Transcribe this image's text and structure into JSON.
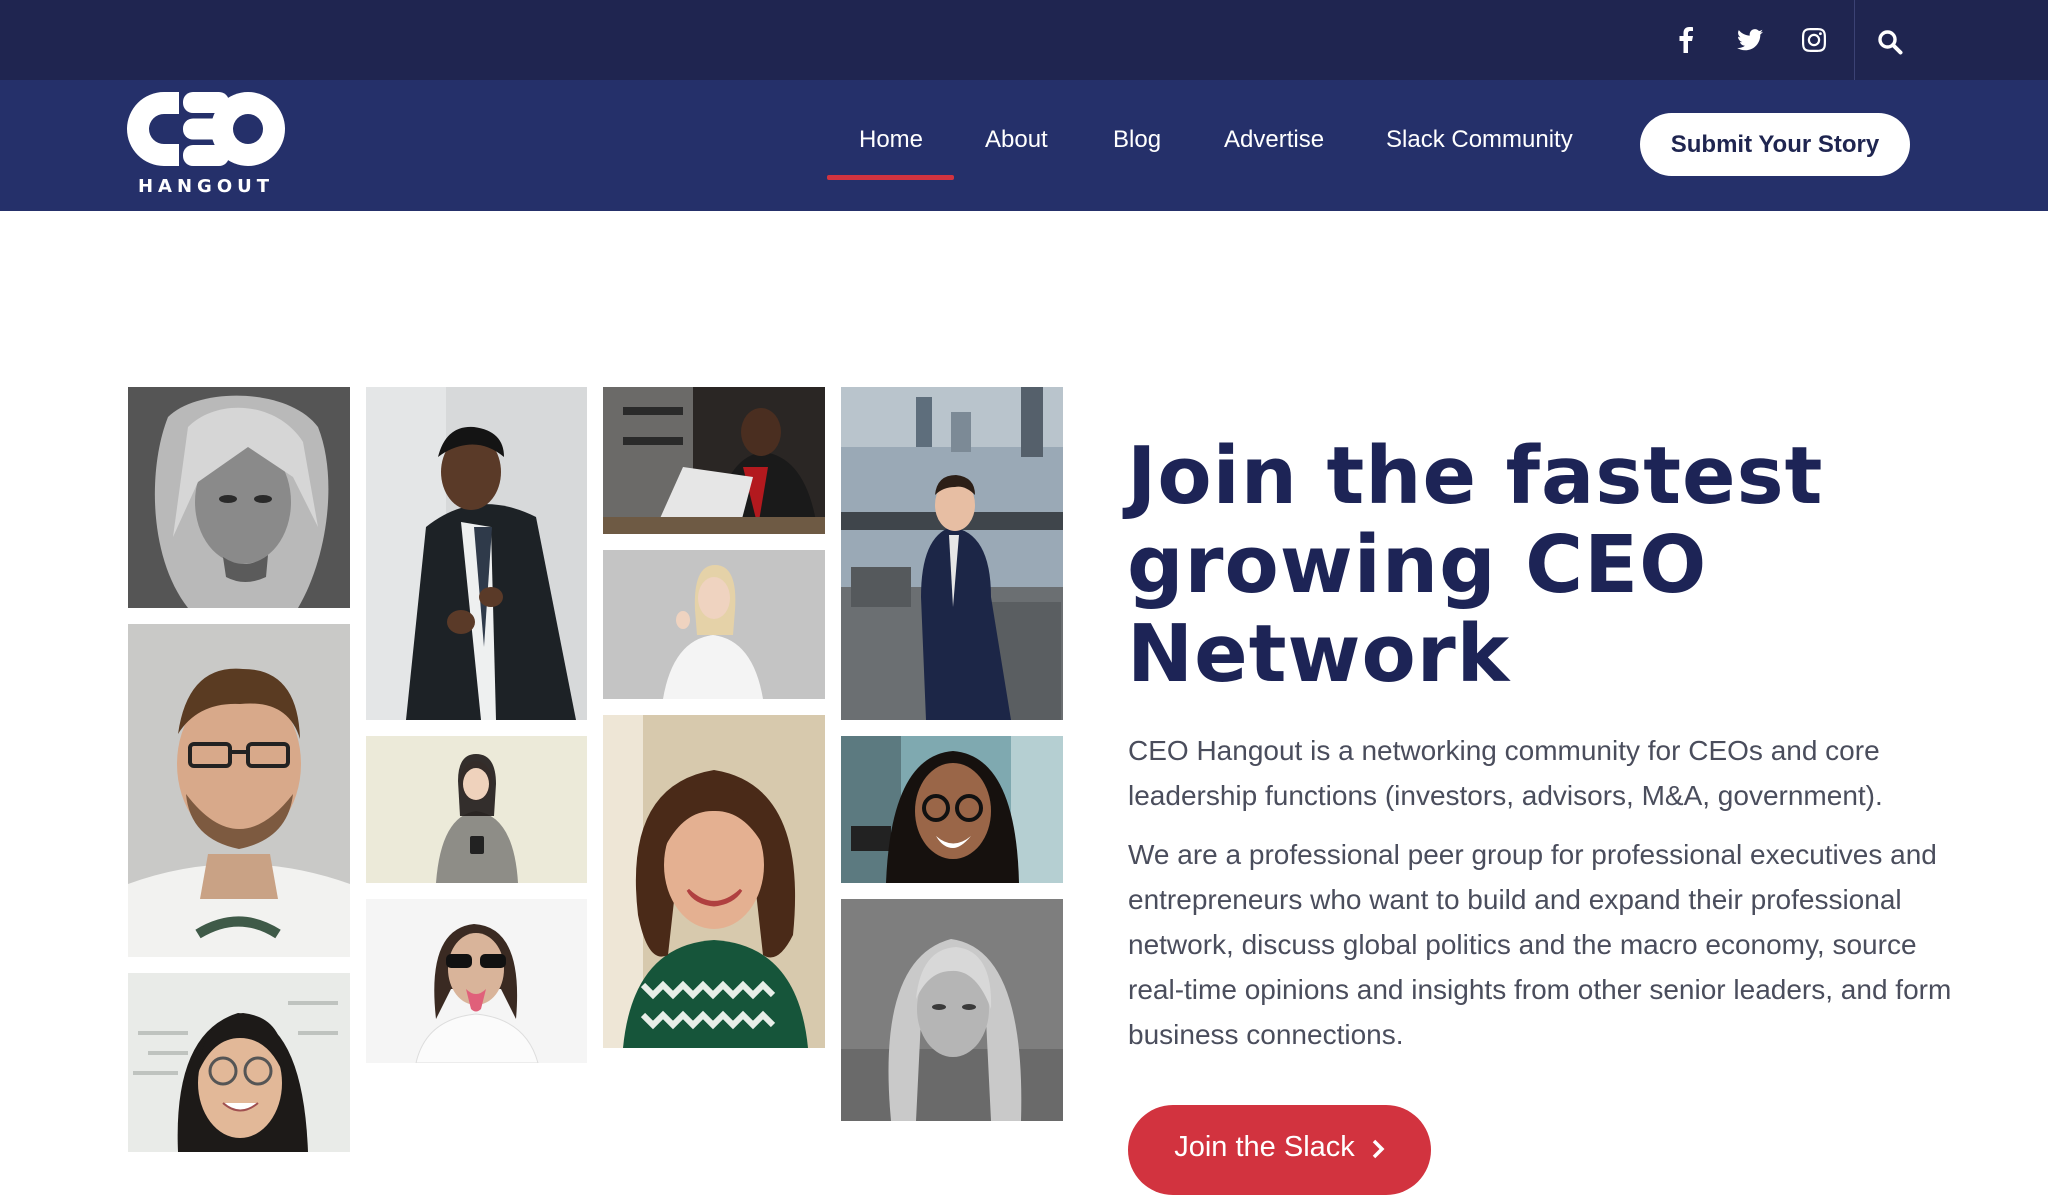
{
  "topbar": {
    "social": [
      {
        "name": "facebook-icon"
      },
      {
        "name": "twitter-icon"
      },
      {
        "name": "instagram-icon"
      }
    ],
    "search_icon": "search-icon"
  },
  "brand": {
    "logo_text": "CEO",
    "logo_sub": "HANGOUT"
  },
  "nav": {
    "items": [
      {
        "label": "Home",
        "active": true
      },
      {
        "label": "About"
      },
      {
        "label": "Blog"
      },
      {
        "label": "Advertise"
      },
      {
        "label": "Slack Community"
      }
    ],
    "cta": "Submit Your Story"
  },
  "hero": {
    "title": "Join the fastest growing CEO Network",
    "paragraph1": "CEO Hangout is a networking community for CEOs and core leadership functions (investors, advisors, M&A, government).",
    "paragraph2": "We are a professional peer group for professional executives and entrepreneurs who want to build and expand their professional network, discuss global politics and the macro economy, source real-time opinions and insights from other senior leaders, and form business connections.",
    "button": "Join the Slack"
  },
  "colors": {
    "topbar": "#1f2550",
    "navbar": "#25306a",
    "accent": "#d2333f",
    "title": "#1d2456"
  }
}
